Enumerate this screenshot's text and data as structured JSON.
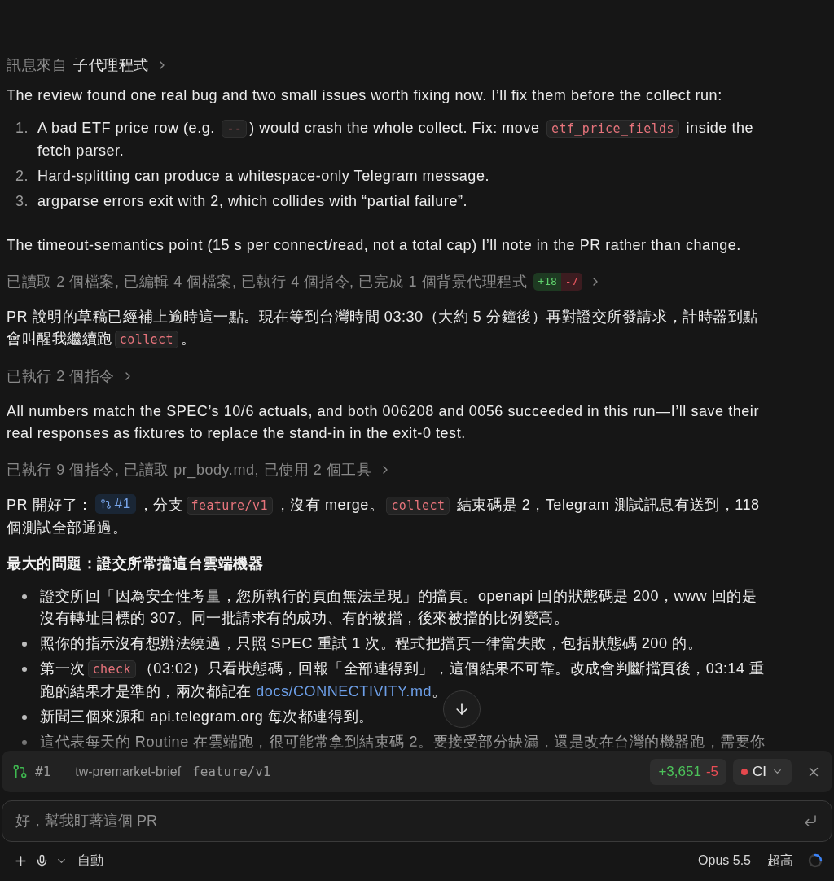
{
  "header": {
    "label": "訊息來自",
    "source": "子代理程式"
  },
  "messages": [
    {
      "kind": "paragraph",
      "parts": [
        {
          "kind": "text",
          "text": "The review found one real bug and two small issues worth fixing now. I’ll fix them before the collect run:"
        }
      ]
    },
    {
      "kind": "ordered_list",
      "items": [
        {
          "number": "1.",
          "parts": [
            {
              "kind": "text",
              "text": "A bad ETF price row (e.g. "
            },
            {
              "kind": "code",
              "text": "--"
            },
            {
              "kind": "text",
              "text": ") would crash the whole collect. Fix: move "
            },
            {
              "kind": "code",
              "text": "etf_price_fields"
            },
            {
              "kind": "text",
              "text": " inside the fetch parser."
            }
          ]
        },
        {
          "number": "2.",
          "parts": [
            {
              "kind": "text",
              "text": "Hard-splitting can produce a whitespace-only Telegram message."
            }
          ]
        },
        {
          "number": "3.",
          "parts": [
            {
              "kind": "text",
              "text": "argparse errors exit with 2, which collides with “partial failure”."
            }
          ]
        }
      ]
    },
    {
      "kind": "paragraph",
      "parts": [
        {
          "kind": "text",
          "text": "The timeout-semantics point (15 s per connect/read, not a total cap) I’ll note in the PR rather than change."
        }
      ]
    },
    {
      "kind": "activity",
      "text": "已讀取 2 個檔案, 已編輯 4 個檔案, 已執行 4 個指令, 已完成 1 個背景代理程式",
      "added": "+18",
      "removed": "-7"
    },
    {
      "kind": "paragraph",
      "parts": [
        {
          "kind": "text",
          "text": "PR 說明的草稿已經補上逾時這一點。現在等到台灣時間 03:30（大約 5 分鐘後）再對證交所發請求，計時器到點會叫醒我繼續跑"
        },
        {
          "kind": "code",
          "text": "collect"
        },
        {
          "kind": "text",
          "text": "。"
        }
      ]
    },
    {
      "kind": "activity",
      "text": "已執行 2 個指令"
    },
    {
      "kind": "paragraph",
      "parts": [
        {
          "kind": "text",
          "text": "All numbers match the SPEC’s 10/6 actuals, and both 006208 and 0056 succeeded in this run—I’ll save their real responses as fixtures to replace the stand-in in the exit-0 test."
        }
      ]
    },
    {
      "kind": "activity",
      "text": "已執行 9 個指令, 已讀取 pr_body.md, 已使用 2 個工具"
    },
    {
      "kind": "paragraph",
      "parts": [
        {
          "kind": "text",
          "text": "PR 開好了："
        },
        {
          "kind": "pr_ref",
          "text": "#1"
        },
        {
          "kind": "text",
          "text": "，分支"
        },
        {
          "kind": "code",
          "text": "feature/v1"
        },
        {
          "kind": "text",
          "text": "，沒有 merge。"
        },
        {
          "kind": "code",
          "text": "collect"
        },
        {
          "kind": "text",
          "text": " 結束碼是 2，Telegram 測試訊息有送到，118 個測試全部通過。"
        }
      ]
    },
    {
      "kind": "heading",
      "text": "最大的問題：證交所常擋這台雲端機器"
    },
    {
      "kind": "bullet_list",
      "items": [
        {
          "parts": [
            {
              "kind": "text",
              "text": "證交所回「因為安全性考量，您所執行的頁面無法呈現」的擋頁。openapi 回的狀態碼是 200，www 回的是沒有轉址目標的 307。同一批請求有的成功、有的被擋，後來被擋的比例變高。"
            }
          ]
        },
        {
          "parts": [
            {
              "kind": "text",
              "text": "照你的指示沒有想辦法繞過，只照 SPEC 重試 1 次。程式把擋頁一律當失敗，包括狀態碼 200 的。"
            }
          ]
        },
        {
          "parts": [
            {
              "kind": "text",
              "text": "第一次"
            },
            {
              "kind": "code",
              "text": "check"
            },
            {
              "kind": "text",
              "text": "（03:02）只看狀態碼，回報「全部連得到」，這個結果不可靠。改成會判斷擋頁後，03:14 重跑的結果才是準的，兩次都記在 "
            },
            {
              "kind": "link",
              "text": "docs/CONNECTIVITY.md"
            },
            {
              "kind": "text",
              "text": "。"
            }
          ]
        },
        {
          "parts": [
            {
              "kind": "text",
              "text": "新聞三個來源和 api.telegram.org 每次都連得到。"
            }
          ]
        },
        {
          "parts": [
            {
              "kind": "text",
              "text": "這代表每天的 Routine 在雲端跑，很可能常拿到結束碼 2。要接受部分缺漏，還是改在台灣的機器跑，需要你"
            }
          ]
        }
      ]
    }
  ],
  "pr_bar": {
    "number": "#1",
    "repo": "tw-premarket-brief",
    "branch": "feature/v1",
    "added": "+3,651",
    "removed": "-5",
    "ci": {
      "label": "CI",
      "passing": false
    }
  },
  "composer": {
    "placeholder": "好，幫我盯著這個 PR",
    "mode": "自動",
    "model": "Opus 5.5",
    "effort": "超高"
  }
}
